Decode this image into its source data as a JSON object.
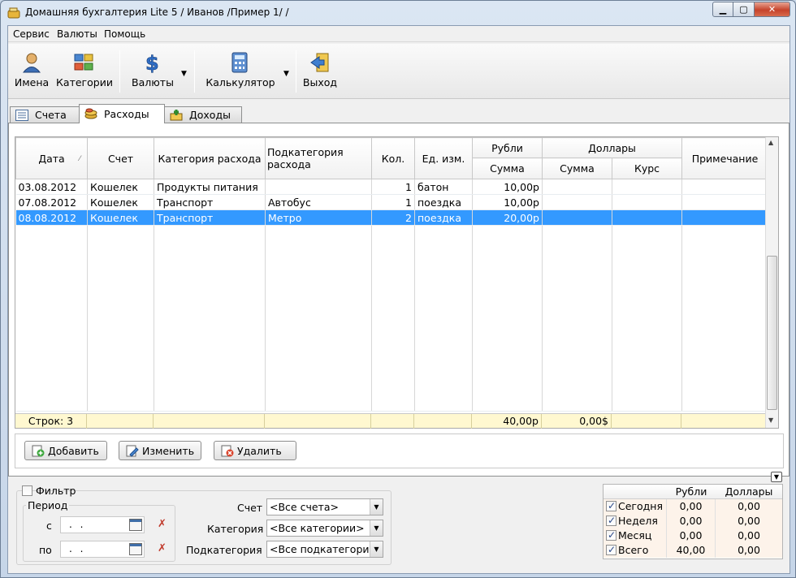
{
  "window": {
    "title": "Домашняя бухгалтерия Lite 5  / Иванов /Пример 1/ /"
  },
  "menu": [
    "Сервис",
    "Валюты",
    "Помощь"
  ],
  "toolbar": {
    "names": "Имена",
    "categories": "Категории",
    "currencies": "Валюты",
    "calculator": "Калькулятор",
    "exit": "Выход"
  },
  "tabs": [
    "Счета",
    "Расходы",
    "Доходы"
  ],
  "grid": {
    "headers": {
      "date": "Дата",
      "account": "Счет",
      "category": "Категория расхода",
      "subcategory": "Подкатегория расхода",
      "qty": "Кол.",
      "unit": "Ед. изм.",
      "rubles": "Рубли",
      "dollars": "Доллары",
      "rub_sum": "Сумма",
      "usd_sum": "Сумма",
      "usd_rate": "Курс",
      "note": "Примечание"
    },
    "rows": [
      {
        "date": "03.08.2012",
        "account": "Кошелек",
        "category": "Продукты питания",
        "subcategory": "",
        "qty": "1",
        "unit": "батон",
        "rub": "10,00р",
        "usd": "",
        "rate": "",
        "note": ""
      },
      {
        "date": "07.08.2012",
        "account": "Кошелек",
        "category": "Транспорт",
        "subcategory": "Автобус",
        "qty": "1",
        "unit": "поездка",
        "rub": "10,00р",
        "usd": "",
        "rate": "",
        "note": ""
      },
      {
        "date": "08.08.2012",
        "account": "Кошелек",
        "category": "Транспорт",
        "subcategory": "Метро",
        "qty": "2",
        "unit": "поездка",
        "rub": "20,00р",
        "usd": "",
        "rate": "",
        "note": ""
      }
    ],
    "footer": {
      "rows_count": "Строк: 3",
      "rub_total": "40,00р",
      "usd_total": "0,00$"
    }
  },
  "actions": {
    "add": "Добавить",
    "edit": "Изменить",
    "delete": "Удалить"
  },
  "filter": {
    "label": "Фильтр",
    "checked": false,
    "period_label": "Период",
    "from_label": "с",
    "to_label": "по",
    "from_value": ". .",
    "to_value": ". .",
    "account_label": "Счет",
    "account_value": "<Все счета>",
    "category_label": "Категория",
    "category_value": "<Все категории>",
    "subcategory_label": "Подкатегория",
    "subcategory_value": "<Все подкатегори"
  },
  "totals": {
    "headers": {
      "rub": "Рубли",
      "usd": "Доллары"
    },
    "rows": [
      {
        "label": "Сегодня",
        "rub": "0,00",
        "usd": "0,00",
        "checked": true
      },
      {
        "label": "Неделя",
        "rub": "0,00",
        "usd": "0,00",
        "checked": true
      },
      {
        "label": "Месяц",
        "rub": "0,00",
        "usd": "0,00",
        "checked": true
      },
      {
        "label": "Всего",
        "rub": "40,00",
        "usd": "0,00",
        "checked": true
      }
    ]
  },
  "colors": {
    "selection": "#3399ff",
    "footer": "#fff8d0",
    "totals_bg": "#fdf3ea"
  }
}
